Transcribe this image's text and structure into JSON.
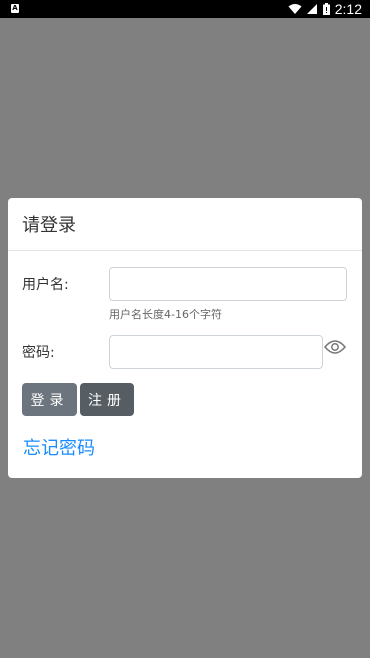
{
  "status_bar": {
    "app_icon_letter": "A",
    "time": "2:12"
  },
  "dialog": {
    "title": "请登录",
    "username": {
      "label": "用户名:",
      "value": "",
      "placeholder": "",
      "hint": "用户名长度4-16个字符"
    },
    "password": {
      "label": "密码:",
      "value": "",
      "placeholder": ""
    },
    "login_button": "登录",
    "register_button": "注册",
    "forgot_password": "忘记密码"
  },
  "colors": {
    "backdrop": "#808080",
    "login_button": "#6c757d",
    "register_button": "#565e64",
    "link": "#1a8cff"
  },
  "icons": [
    "wifi-icon",
    "signal-icon",
    "battery-icon",
    "eye-icon"
  ]
}
